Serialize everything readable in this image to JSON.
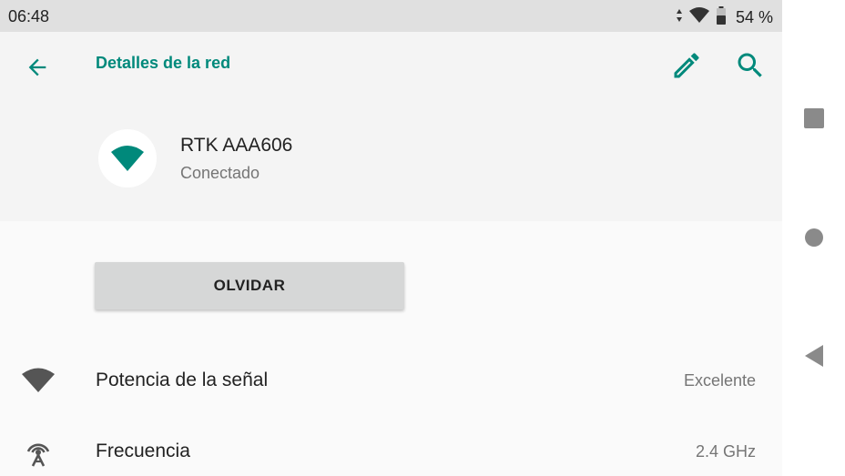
{
  "status_bar": {
    "time": "06:48",
    "battery_percent": "54 %",
    "icons": [
      "data-arrows-icon",
      "wifi-signal-icon",
      "battery-icon"
    ]
  },
  "app_bar": {
    "title": "Detalles de la red",
    "back_icon": "arrow-left-icon",
    "edit_icon": "pencil-icon",
    "search_icon": "search-icon"
  },
  "network": {
    "name": "RTK AAA606",
    "status": "Conectado",
    "icon": "wifi-icon"
  },
  "forget_button": {
    "label": "OLVIDAR"
  },
  "details": [
    {
      "label": "Potencia de la señal",
      "value": "Excelente",
      "icon": "wifi-signal-icon"
    },
    {
      "label": "Frecuencia",
      "value": "2.4 GHz",
      "icon": "antenna-icon"
    }
  ],
  "nav_bar": {
    "buttons": [
      "recents-square-icon",
      "home-circle-icon",
      "back-triangle-icon"
    ]
  },
  "colors": {
    "accent": "#00897b",
    "status_bar": "#e0e0e0",
    "header_bg": "#f4f4f4",
    "button_bg": "#d6d7d7"
  }
}
